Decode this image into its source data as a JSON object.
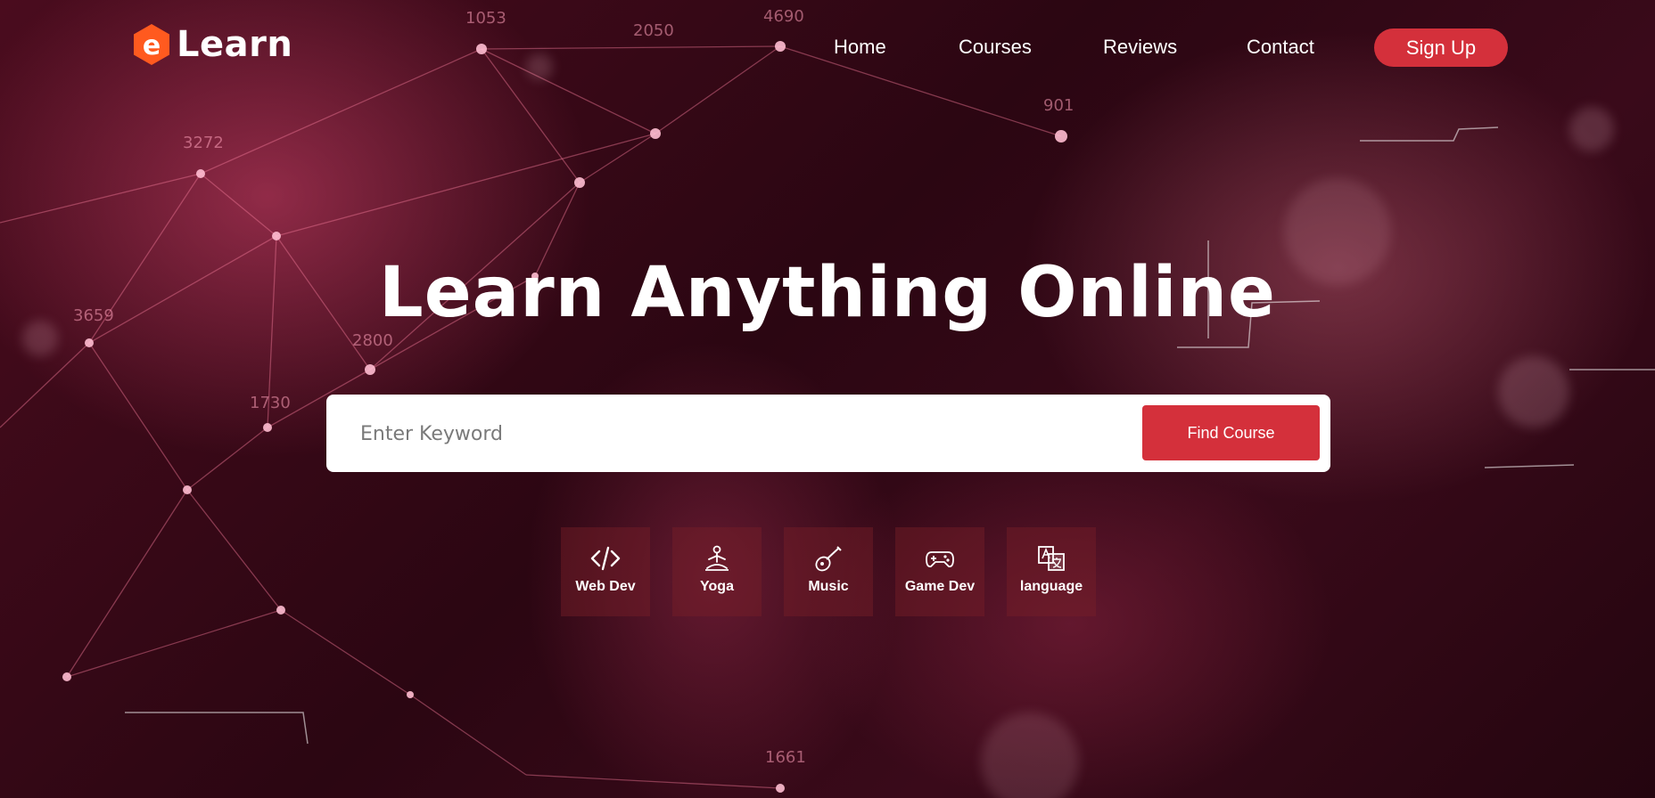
{
  "brand": {
    "logo_letter": "e",
    "name": "Learn",
    "accent": "#d4303b",
    "logo_color": "#ff5a1f"
  },
  "nav": {
    "items": [
      {
        "label": "Home"
      },
      {
        "label": "Courses"
      },
      {
        "label": "Reviews"
      },
      {
        "label": "Contact"
      }
    ],
    "signup_label": "Sign Up"
  },
  "hero": {
    "title": "Learn Anything Online",
    "search": {
      "placeholder": "Enter Keyword",
      "value": "",
      "button_label": "Find Course"
    }
  },
  "categories": [
    {
      "label": "Web Dev",
      "icon": "code-icon"
    },
    {
      "label": "Yoga",
      "icon": "yoga-icon"
    },
    {
      "label": "Music",
      "icon": "guitar-icon"
    },
    {
      "label": "Game Dev",
      "icon": "gamepad-icon"
    },
    {
      "label": "language",
      "icon": "translate-icon"
    }
  ],
  "background_numbers": [
    "1053",
    "2050",
    "4690",
    "901",
    "3272",
    "3659",
    "2800",
    "1730",
    "1661"
  ]
}
